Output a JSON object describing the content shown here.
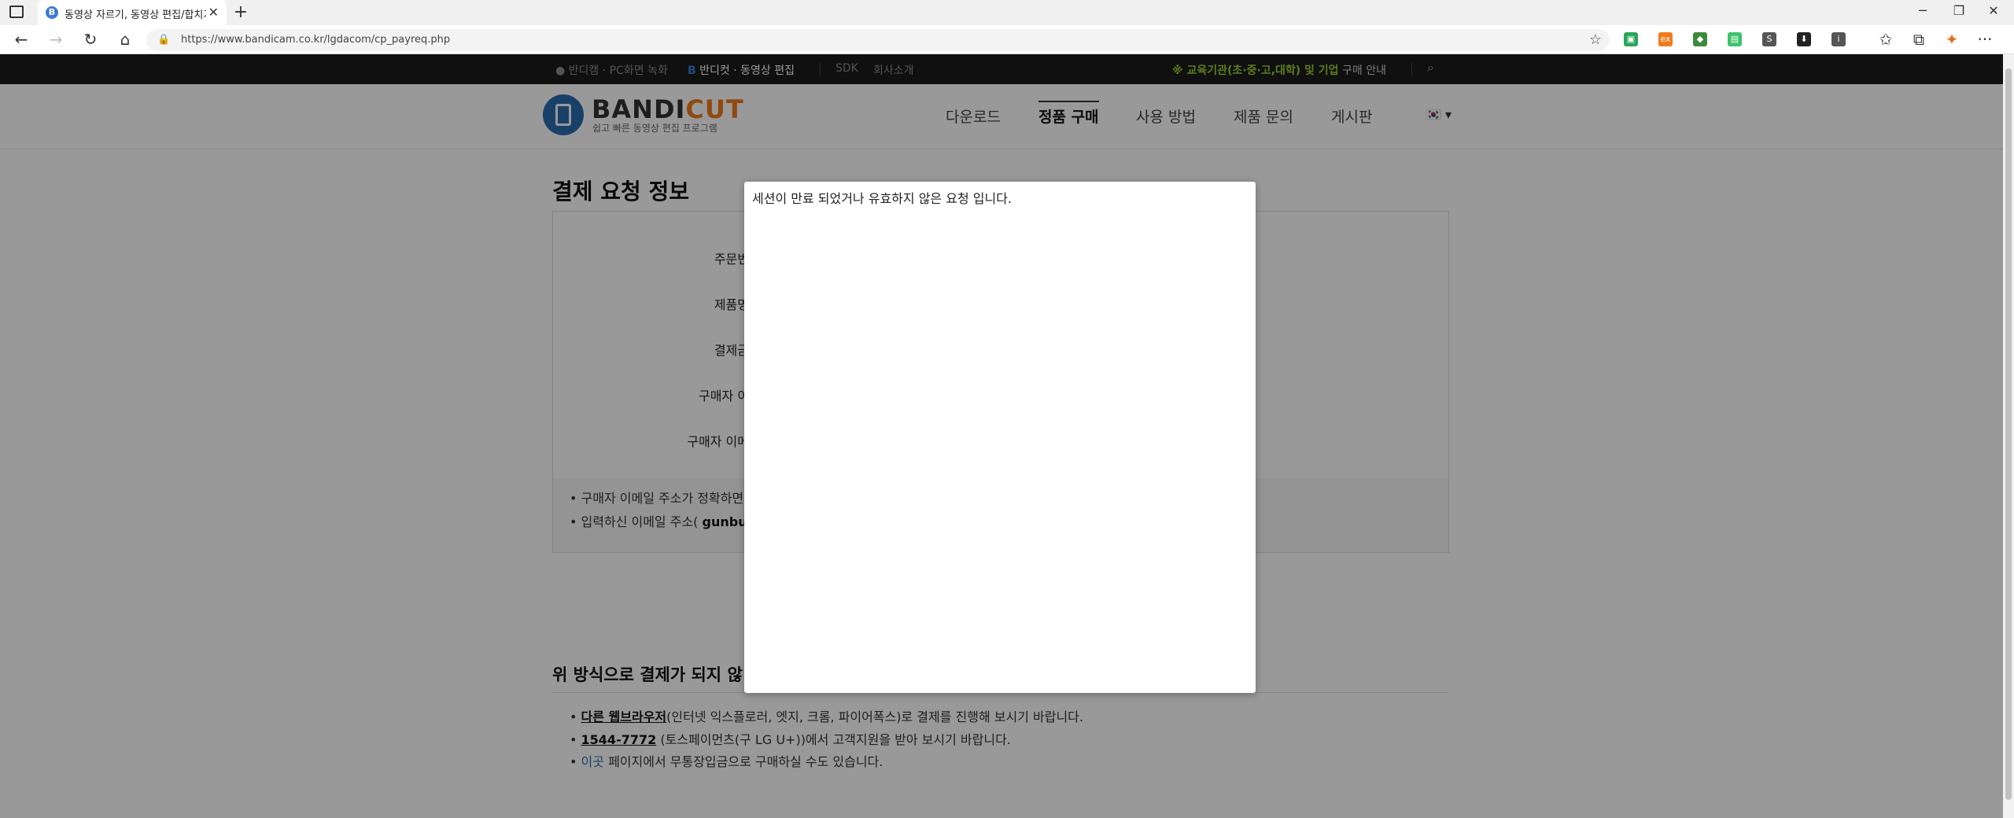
{
  "browser": {
    "tab_title": "동영상 자르기, 동영상 편집/합치기",
    "tab_favicon": "B",
    "new_tab": "+",
    "url": "https://www.bandicam.co.kr/lgdacom/cp_payreq.php",
    "icons": [
      "sidebar-icon",
      "back-icon",
      "forward-icon",
      "refresh-icon",
      "home-icon",
      "lock-icon",
      "favorite-star-icon",
      "minimize-icon",
      "restore-icon",
      "close-icon",
      "favorites-icon",
      "collections-icon",
      "more-icon"
    ],
    "extensions": [
      {
        "name": "ext-green",
        "color": "#2aa55a",
        "glyph": "▣"
      },
      {
        "name": "ext-orange",
        "color": "#f07a1a",
        "glyph": "ex"
      },
      {
        "name": "ext-cube",
        "color": "#3b8a3b",
        "glyph": "◆"
      },
      {
        "name": "ext-green2",
        "color": "#3cc36a",
        "glyph": "▤"
      },
      {
        "name": "ext-s",
        "color": "#555555",
        "glyph": "S"
      },
      {
        "name": "ext-download",
        "color": "#222222",
        "glyph": "⬇"
      },
      {
        "name": "ext-info",
        "color": "#555555",
        "glyph": "i"
      }
    ]
  },
  "site": {
    "top_links": {
      "bandicam": "반디캠 · PC화면 녹화",
      "bandicut": "반디컷 · 동영상 편집",
      "sdk": "SDK",
      "company": "회사소개",
      "edu_prefix": "※ 교육기관(초·중·고,대학) 및 기업",
      "edu_suffix": " 구매 안내"
    },
    "logo": {
      "main": "BANDI",
      "accent": "CUT",
      "subtitle": "쉽고 빠른 동영상 편집 프로그램"
    },
    "nav": [
      "다운로드",
      "정품 구매",
      "사용 방법",
      "제품 문의",
      "게시판"
    ],
    "lang": "🇰🇷 ▾",
    "colors": {
      "accent_green": "#9acd32",
      "logo_orange": "#f07a1a",
      "logo_blue": "#2b6cb0",
      "link_blue": "#2b6cb0"
    }
  },
  "page": {
    "title": "결제 요청 정보",
    "form_labels": [
      "주문번",
      "제품명",
      "결제금",
      "구매자 이",
      "구매자 이메"
    ],
    "notes": [
      {
        "text": "구매자 이메일 주소가 정확하면",
        "bold": ""
      },
      {
        "text": "입력하신 이메일 주소( ",
        "bold": "gunbus"
      }
    ],
    "sub_title": "위 방식으로 결제가 되지 않",
    "help_items": [
      {
        "link": "다른 웹브라우저",
        "rest": "(인터넷 익스플로러, 엣지, 크롬, 파이어폭스)로 결제를 진행해 보시기 바랍니다."
      },
      {
        "link": "1544-7772",
        "rest": " (토스페이먼츠(구 LG U+))에서 고객지원을 받아 보시기 바랍니다."
      },
      {
        "link": "이곳",
        "rest": " 페이지에서 무통장입금으로 구매하실 수도 있습니다."
      }
    ]
  },
  "modal": {
    "message": "세션이 만료 되었거나 유효하지 않은 요청 입니다."
  }
}
